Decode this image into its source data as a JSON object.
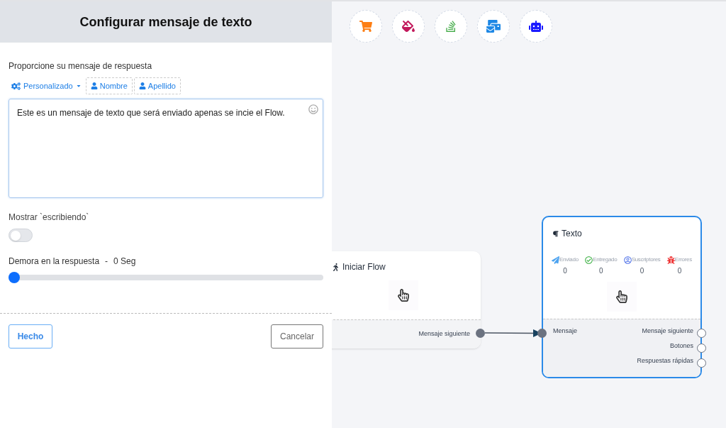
{
  "panel": {
    "title": "Configurar mensaje de texto",
    "prompt_label": "Proporcione su mensaje de respuesta",
    "tag_buttons": [
      {
        "kind": "dropdown",
        "label": "Personalizado"
      },
      {
        "kind": "field",
        "label": "Nombre"
      },
      {
        "kind": "field",
        "label": "Apellido"
      }
    ],
    "message": "Este es un mensaje de texto que será enviado apenas se incie el Flow.",
    "typing": {
      "label": "Mostrar `escribiendo`",
      "on": false
    },
    "delay": {
      "label": "Demora en la respuesta",
      "separator": "-",
      "reading": "0 Seg",
      "level": 0
    },
    "buttons": {
      "done": "Hecho",
      "cancel": "Cancelar"
    }
  },
  "start_node": {
    "title": "Iniciar Flow",
    "output": "Mensaje siguiente"
  },
  "text_node": {
    "title": "Texto",
    "selected": true,
    "stats": [
      {
        "kind": "sent",
        "label": "Enviado",
        "value": "0"
      },
      {
        "kind": "delivered",
        "label": "Entregado",
        "value": "0"
      },
      {
        "kind": "subscribers",
        "label": "Suscriptores",
        "value": "0"
      },
      {
        "kind": "errors",
        "label": "Errores",
        "value": "0"
      }
    ],
    "input": "Mensaje",
    "outputs": [
      "Mensaje siguiente",
      "Botones",
      "Respuestas rápidas"
    ]
  }
}
